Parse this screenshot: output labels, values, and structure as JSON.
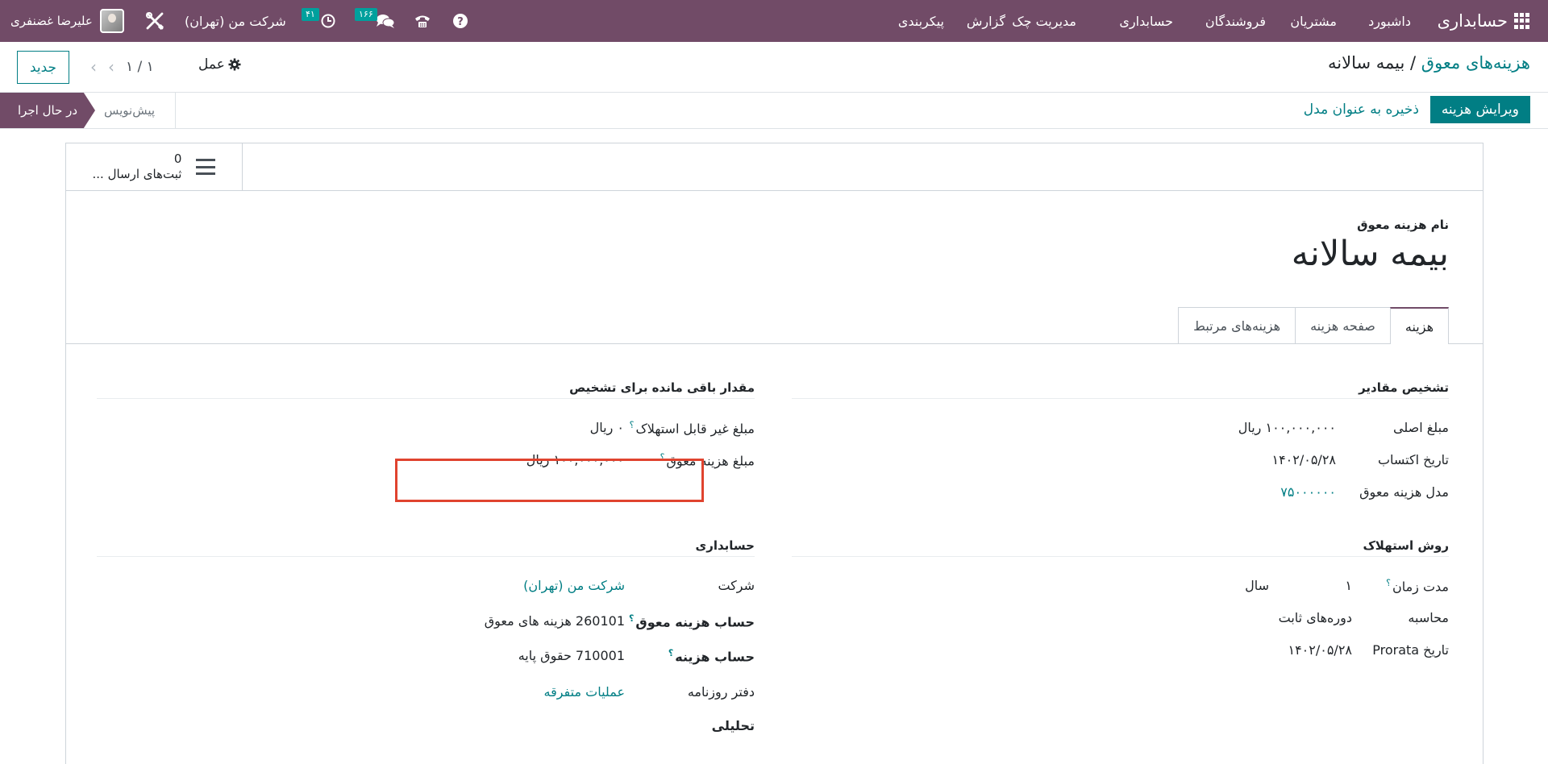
{
  "navbar": {
    "app_name": "حسابداری",
    "menu": [
      "داشبورد",
      "مشتریان",
      "فروشندگان",
      "حسابداری",
      "مدیریت چک",
      "گزارش",
      "پیکربندی"
    ],
    "messages_count": "۱۶۶",
    "activities_count": "۴۱",
    "company": "شرکت من (تهران)",
    "user_name": "علیرضا غضنفری",
    "colors": {
      "bar": "#714b67",
      "badge": "#00a09d"
    }
  },
  "control_panel": {
    "breadcrumb_parent": "هزینه‌های معوق",
    "breadcrumb_sep": "/",
    "breadcrumb_current": "بیمه سالانه",
    "new_button": "جدید",
    "pager": "۱ / ۱",
    "action_label": "عمل"
  },
  "statusbar": {
    "edit_button": "ویرایش هزینه",
    "save_model_button": "ذخیره به عنوان مدل",
    "stage_running": "در حال اجرا",
    "stage_draft": "پیش‌نویس"
  },
  "smart_button": {
    "count": "0",
    "label": "ثبت‌های ارسال ..."
  },
  "form": {
    "name_label": "نام هزینه معوق",
    "name_value": "بیمه سالانه",
    "tabs": [
      "هزینه",
      "صفحه هزینه",
      "هزینه‌های مرتبط"
    ],
    "values_section": {
      "title": "تشخیص مقادیر",
      "original_amount_label": "مبلغ اصلی",
      "original_amount_value": "۱۰۰,۰۰۰,۰۰۰ ریال",
      "acquisition_date_label": "تاریخ اکتساب",
      "acquisition_date_value": "۱۴۰۲/۰۵/۲۸",
      "model_label": "مدل هزینه معوق",
      "model_value": "۷۵۰۰۰۰۰۰"
    },
    "residual_section": {
      "title": "مقدار باقی مانده برای تشخیص",
      "non_depreciable_label": "مبلغ غیر قابل استهلاک",
      "non_depreciable_value": "۰ ریال",
      "deferred_amount_label": "مبلغ هزینه معوق",
      "deferred_amount_value": "۱۰۰,۰۰۰,۰۰۰ ریال"
    },
    "method_section": {
      "title": "روش استهلاک",
      "duration_label": "مدت زمان",
      "duration_number": "۱",
      "duration_unit": "سال",
      "computation_label": "محاسبه",
      "computation_value": "دوره‌های ثابت",
      "prorata_label": "تاریخ Prorata",
      "prorata_value": "۱۴۰۲/۰۵/۲۸"
    },
    "accounting_section": {
      "title": "حسابداری",
      "company_label": "شرکت",
      "company_value": "شرکت من (تهران)",
      "deferred_account_label": "حساب هزینه معوق",
      "deferred_account_value": "260101 هزینه های معوق",
      "expense_account_label": "حساب هزینه",
      "expense_account_value": "710001 حقوق پایه",
      "journal_label": "دفتر روزنامه",
      "journal_value": "عملیات متفرقه",
      "analytic_label": "تحلیلی"
    },
    "highlight_color": "#e0432f"
  }
}
